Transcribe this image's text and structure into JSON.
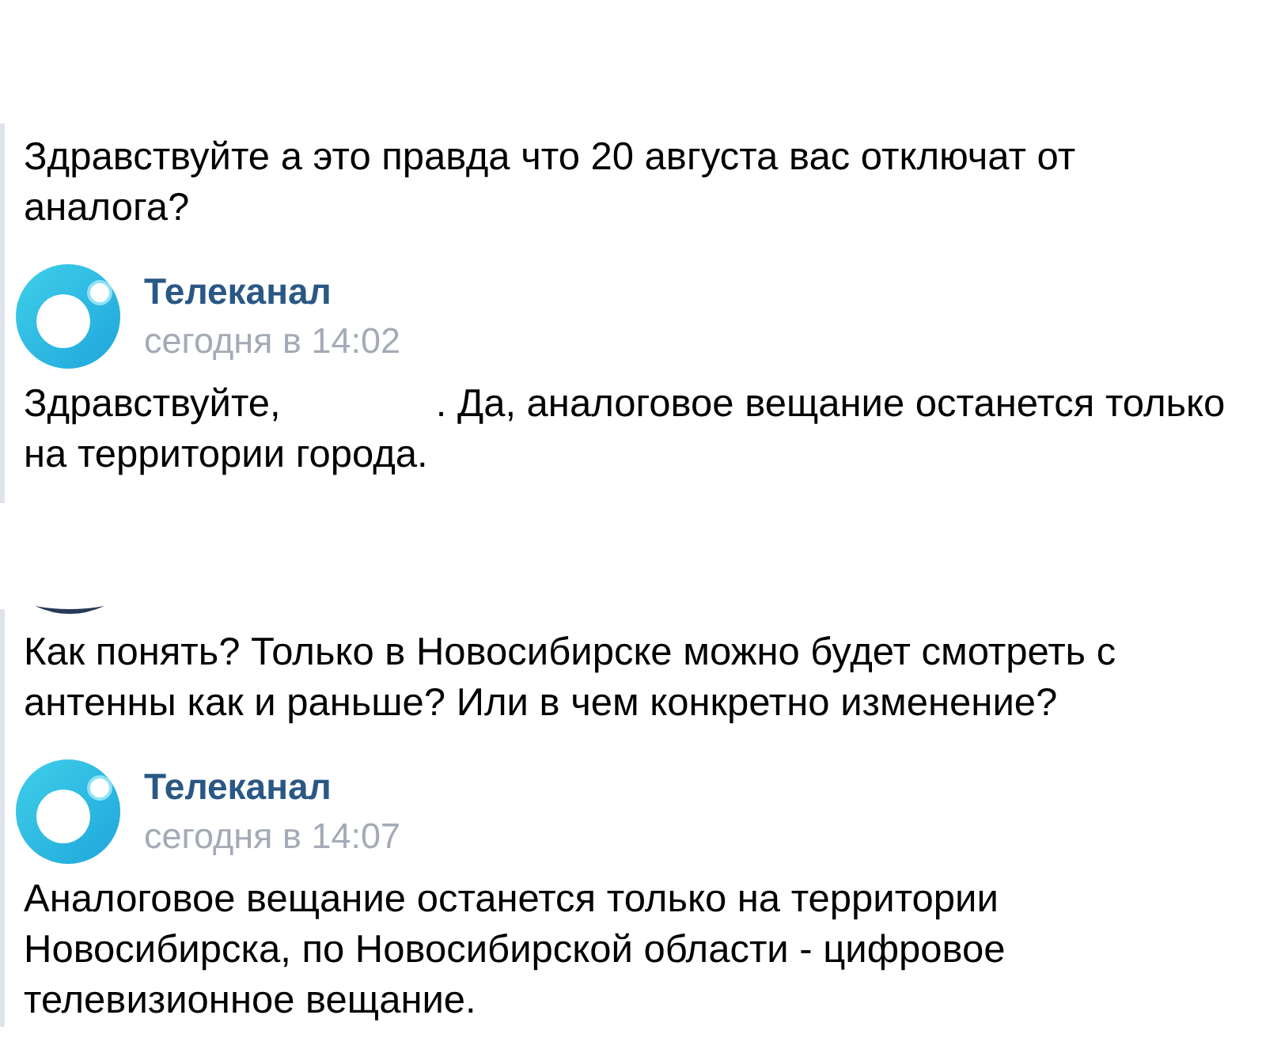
{
  "threads": [
    {
      "question": {
        "avatar_cropped": false,
        "text": "Здравствуйте а это правда что 20 августа вас отключат от аналога?"
      },
      "reply": {
        "author": "Телеканал",
        "time": "сегодня в 14:02",
        "text_parts": [
          "Здравствуйте,",
          ". Да, аналоговое вещание останется только на территории города."
        ]
      }
    },
    {
      "question": {
        "avatar_cropped": true,
        "text": "Как понять? Только в Новосибирске можно будет смотреть с антенны как и раньше? Или в чем конкретно изменение?"
      },
      "reply": {
        "author": "Телеканал",
        "time": "сегодня в 14:07",
        "text_parts": [
          "Аналоговое вещание останется только на территории Новосибирска, по Новосибирской области - цифровое телевизионное вещание."
        ]
      }
    }
  ]
}
